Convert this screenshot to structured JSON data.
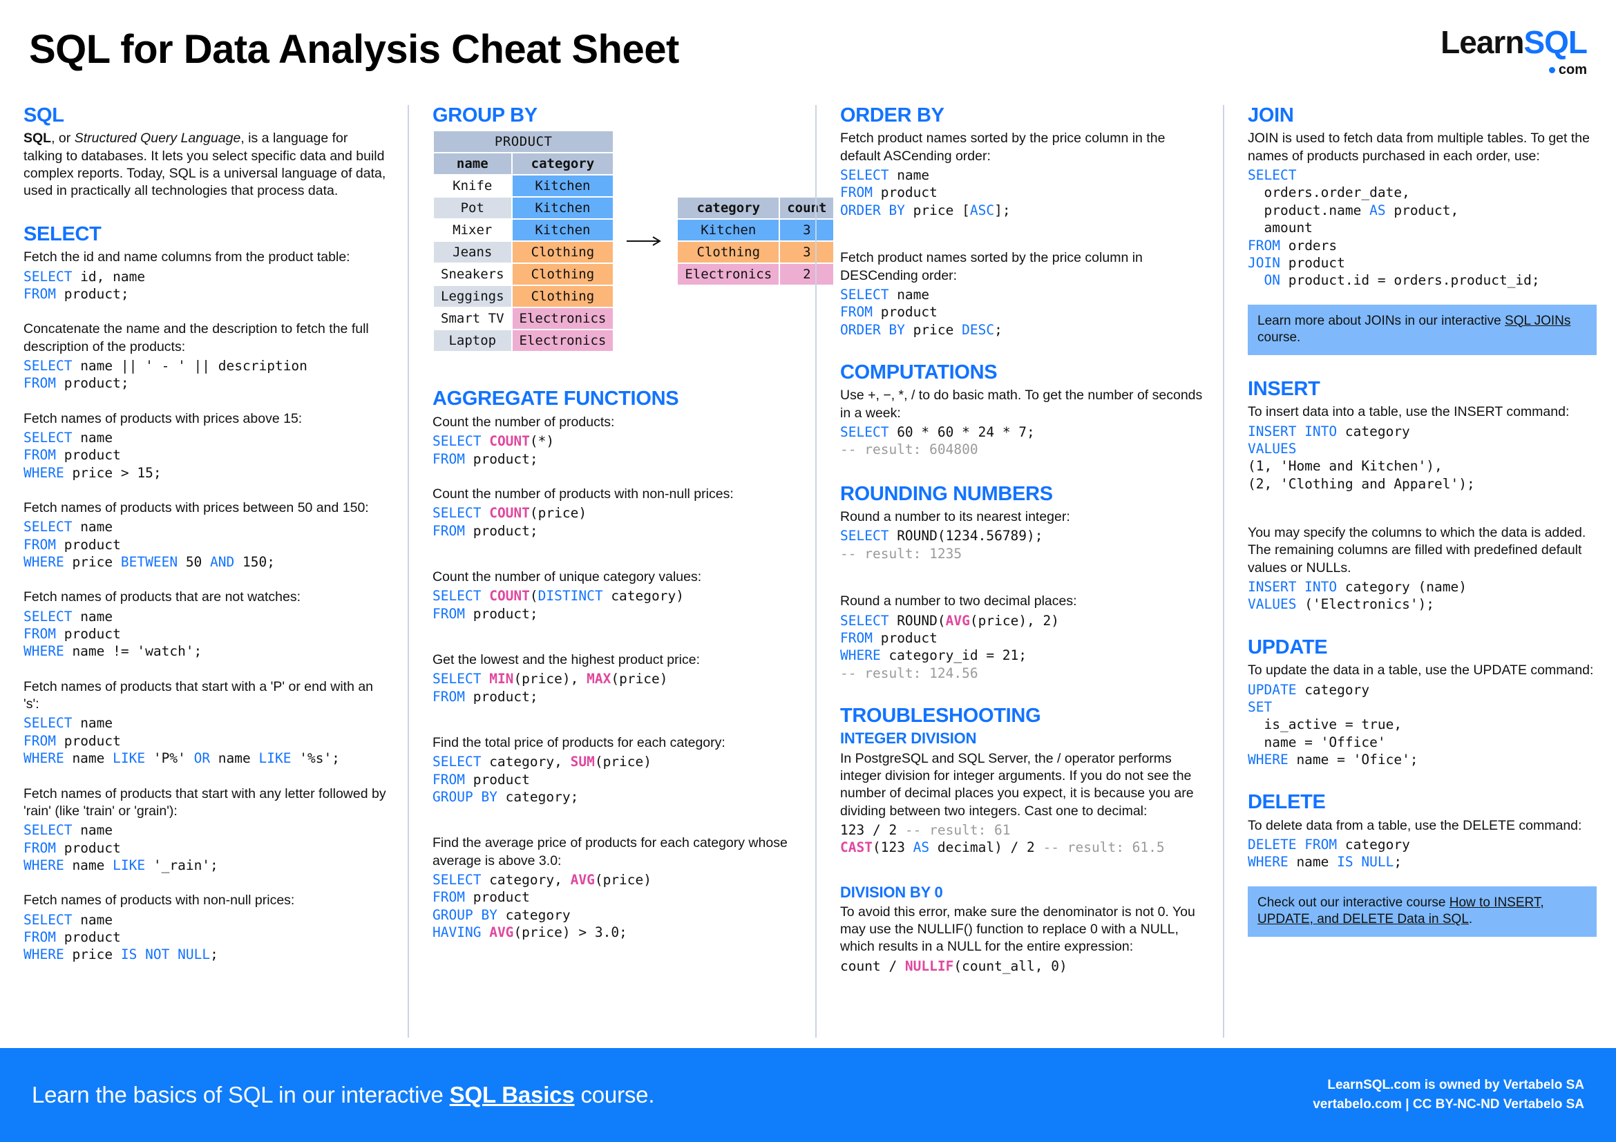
{
  "header": {
    "title": "SQL for Data Analysis Cheat Sheet",
    "logo_learn": "Learn",
    "logo_sql": "SQL",
    "logo_com": "com"
  },
  "col1": {
    "sql": {
      "heading": "SQL",
      "intro_bold": "SQL",
      "intro_a": ", or ",
      "intro_ital": "Structured Query Language",
      "intro_b": ", is a language for talking to databases. It lets you select specific data and build complex reports. Today, SQL is a universal language of data, used in practically all technologies that process data."
    },
    "select": {
      "heading": "SELECT",
      "items": [
        {
          "desc": "Fetch the id and name columns from the product table:",
          "code": "SELECT id, name\nFROM product;"
        },
        {
          "desc": "Concatenate the name and the description to fetch the full description of the products:",
          "code": "SELECT name || ' - ' || description\nFROM product;"
        },
        {
          "desc": "Fetch names of products with prices above 15:",
          "code": "SELECT name\nFROM product\nWHERE price > 15;"
        },
        {
          "desc": "Fetch names of products with prices between 50 and 150:",
          "code": "SELECT name\nFROM product\nWHERE price BETWEEN 50 AND 150;"
        },
        {
          "desc": "Fetch names of products that are not watches:",
          "code": "SELECT name\nFROM product\nWHERE name != 'watch';"
        },
        {
          "desc": "Fetch names of products that start with a 'P' or end with an 's':",
          "code": "SELECT name\nFROM product\nWHERE name LIKE 'P%' OR name LIKE '%s';"
        },
        {
          "desc": "Fetch names of products that start with any letter followed by 'rain' (like 'train' or 'grain'):",
          "code": "SELECT name\nFROM product\nWHERE name LIKE '_rain';"
        },
        {
          "desc": "Fetch names of products with non-null prices:",
          "code": "SELECT name\nFROM product\nWHERE price IS NOT NULL;"
        }
      ]
    }
  },
  "col2": {
    "groupby": {
      "heading": "GROUP BY"
    },
    "aggregate": {
      "heading": "AGGREGATE FUNCTIONS",
      "items": [
        {
          "desc": "Count the number of products:",
          "code": "SELECT COUNT(*)\nFROM product;"
        },
        {
          "desc": "Count the number of products with non-null prices:",
          "code": "SELECT COUNT(price)\nFROM product;"
        },
        {
          "desc": "Count the number of unique category values:",
          "code": "SELECT COUNT(DISTINCT category)\nFROM product;"
        },
        {
          "desc": "Get the lowest and the highest product price:",
          "code": "SELECT MIN(price), MAX(price)\nFROM product;"
        },
        {
          "desc": "Find the total price of products for each category:",
          "code": "SELECT category, SUM(price)\nFROM product\nGROUP BY category;"
        },
        {
          "desc": "Find the average price of products for each category whose average is above 3.0:",
          "code": "SELECT category, AVG(price)\nFROM product\nGROUP BY category\nHAVING AVG(price) > 3.0;"
        }
      ]
    }
  },
  "col3": {
    "orderby": {
      "heading": "ORDER BY",
      "items": [
        {
          "desc": "Fetch product names sorted by the price column in the default ASCending order:",
          "code": "SELECT name\nFROM product\nORDER BY price [ASC];"
        },
        {
          "desc": "Fetch product names sorted by the price column in DESCending order:",
          "code": "SELECT name\nFROM product\nORDER BY price DESC;"
        }
      ]
    },
    "computations": {
      "heading": "COMPUTATIONS",
      "desc": "Use +, −, *, / to do basic math. To get the number of seconds in a week:",
      "code": "SELECT 60 * 60 * 24 * 7;\n-- result: 604800"
    },
    "rounding": {
      "heading": "ROUNDING NUMBERS",
      "items": [
        {
          "desc": "Round a number to its nearest integer:",
          "code": "SELECT ROUND(1234.56789);\n-- result: 1235"
        },
        {
          "desc": "Round a number to two decimal places:",
          "code": "SELECT ROUND(AVG(price), 2)\nFROM product\nWHERE category_id = 21;\n-- result: 124.56"
        }
      ]
    },
    "troubleshooting": {
      "heading": "TROUBLESHOOTING",
      "integer_division": {
        "heading": "INTEGER DIVISION",
        "desc": "In PostgreSQL and SQL Server, the / operator performs integer division for integer arguments. If you do not see the number of decimal places you expect, it is because you are dividing between two integers. Cast one to decimal:",
        "code": "123 / 2 -- result: 61\nCAST(123 AS decimal) / 2 -- result: 61.5"
      },
      "division_by_zero": {
        "heading": "DIVISION BY 0",
        "desc": "To avoid this error, make sure the denominator is not 0. You may use the NULLIF() function to replace 0 with a NULL, which results in a NULL for the entire expression:",
        "code": "count / NULLIF(count_all, 0)"
      }
    }
  },
  "col4": {
    "join": {
      "heading": "JOIN",
      "desc": "JOIN is used to fetch data from multiple tables. To get the names of products purchased in each order, use:",
      "code": "SELECT\n  orders.order_date,\n  product.name AS product,\n  amount\nFROM orders\nJOIN product\n  ON product.id = orders.product_id;",
      "callout_pre": "Learn more about JOINs in our interactive ",
      "callout_link": "SQL JOINs",
      "callout_post": " course."
    },
    "insert": {
      "heading": "INSERT",
      "desc1": "To insert data into a table, use the INSERT command:",
      "code1": "INSERT INTO category\nVALUES\n(1, 'Home and Kitchen'),\n(2, 'Clothing and Apparel');",
      "desc2": "You may specify the columns to which the data is added. The remaining columns are filled with predefined default values or NULLs.",
      "code2": "INSERT INTO category (name)\nVALUES ('Electronics');"
    },
    "update": {
      "heading": "UPDATE",
      "desc": "To update the data in a table, use the UPDATE command:",
      "code": "UPDATE category\nSET\n  is_active = true,\n  name = 'Office'\nWHERE name = 'Ofice';"
    },
    "delete": {
      "heading": "DELETE",
      "desc": "To delete data from a table, use the DELETE command:",
      "code": "DELETE FROM category\nWHERE name IS NULL;",
      "callout_pre": "Check out our interactive course ",
      "callout_link": "How to INSERT, UPDATE, and DELETE Data in SQL",
      "callout_post": "."
    }
  },
  "footer": {
    "left_pre": "Learn the basics of SQL in our interactive ",
    "left_link": "SQL Basics",
    "left_post": " course.",
    "right_line1": "LearnSQL.com is owned by Vertabelo SA",
    "right_line2": "vertabelo.com | CC BY-NC-ND Vertabelo SA"
  },
  "chart_data": {
    "type": "table",
    "title": "GROUP BY illustration",
    "source_table": {
      "name": "PRODUCT",
      "columns": [
        "name",
        "category"
      ],
      "rows": [
        [
          "Knife",
          "Kitchen"
        ],
        [
          "Pot",
          "Kitchen"
        ],
        [
          "Mixer",
          "Kitchen"
        ],
        [
          "Jeans",
          "Clothing"
        ],
        [
          "Sneakers",
          "Clothing"
        ],
        [
          "Leggings",
          "Clothing"
        ],
        [
          "Smart TV",
          "Electronics"
        ],
        [
          "Laptop",
          "Electronics"
        ]
      ]
    },
    "result_table": {
      "columns": [
        "category",
        "count"
      ],
      "rows": [
        [
          "Kitchen",
          "3"
        ],
        [
          "Clothing",
          "3"
        ],
        [
          "Electronics",
          "2"
        ]
      ]
    },
    "colors": {
      "kitchen": "#62aefb",
      "clothing": "#fcb678",
      "electronics": "#eeaed1",
      "header": "#b3c2d8",
      "row_alt": "#d7dee8",
      "accent": "#1273ff",
      "function": "#e0479e"
    }
  }
}
